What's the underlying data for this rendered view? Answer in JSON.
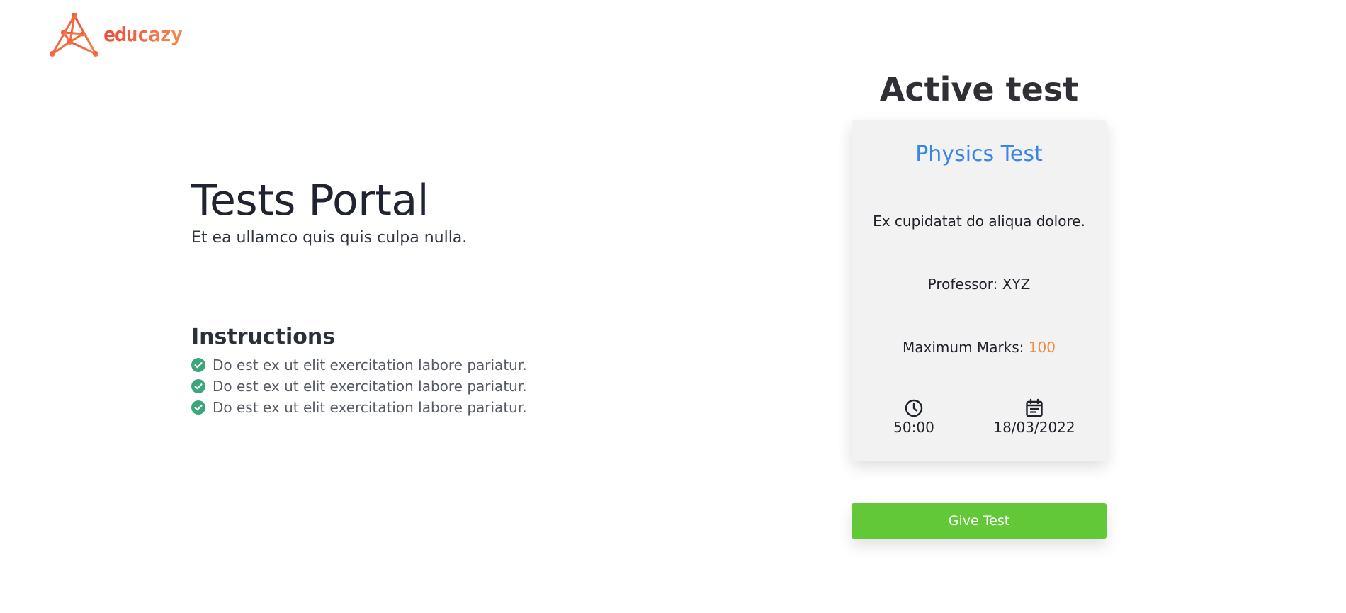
{
  "brand": {
    "name": "educazy",
    "colors": {
      "start": "#ee4a3a",
      "end": "#f7894a"
    }
  },
  "hero": {
    "title": "Tests Portal",
    "subtitle": "Et ea ullamco quis quis culpa nulla."
  },
  "instructions": {
    "title": "Instructions",
    "icon": "check-circle-icon",
    "icon_color": "#3aa67a",
    "items": [
      "Do est ex ut elit exercitation labore pariatur.",
      "Do est ex ut elit exercitation labore pariatur.",
      "Do est ex ut elit exercitation labore pariatur."
    ]
  },
  "active_test": {
    "heading": "Active test",
    "title": "Physics Test",
    "description": "Ex cupidatat do aliqua dolore.",
    "professor": "Professor: XYZ",
    "max_marks_label": "Maximum Marks:",
    "max_marks_value": "100",
    "duration": "50:00",
    "duration_icon": "clock-icon",
    "date": "18/03/2022",
    "date_icon": "calendar-icon",
    "button_label": "Give Test",
    "colors": {
      "title": "#3a86e6",
      "marks": "#f1893b",
      "button": "#62c837"
    }
  }
}
